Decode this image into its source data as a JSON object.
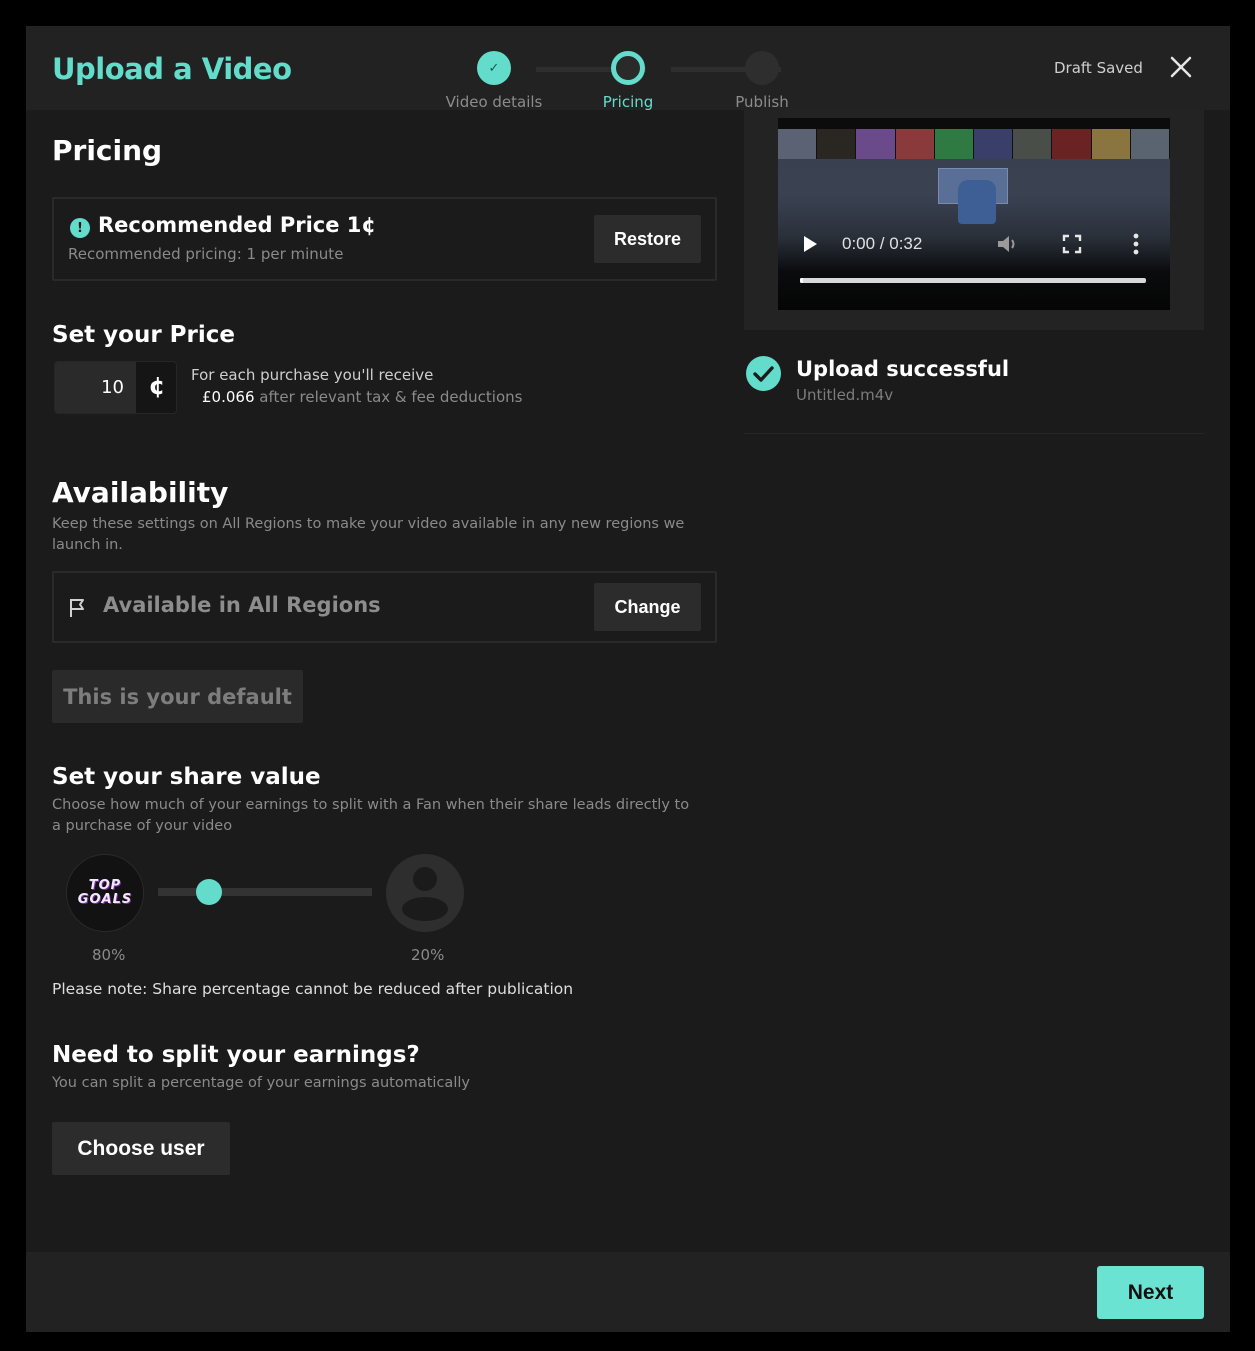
{
  "header": {
    "title": "Upload a Video",
    "draft_status": "Draft Saved",
    "close_icon": "close-icon"
  },
  "stepper": {
    "steps": [
      {
        "label": "Video details",
        "state": "done"
      },
      {
        "label": "Pricing",
        "state": "current"
      },
      {
        "label": "Publish",
        "state": "todo"
      }
    ],
    "check_glyph": "✓"
  },
  "pricing": {
    "title": "Pricing",
    "recommended": {
      "icon_glyph": "!",
      "title": "Recommended Price 1¢",
      "subtitle": "Recommended pricing: 1 per minute",
      "restore_label": "Restore"
    },
    "set_price": {
      "title": "Set your Price",
      "value": "10",
      "unit_glyph": "¢",
      "receive_line1": "For each purchase you'll receive",
      "receive_amount": "£0.066",
      "receive_suffix": " after relevant tax & fee deductions"
    }
  },
  "availability": {
    "title": "Availability",
    "description": "Keep these settings on All Regions to make your video available in any new regions we launch in.",
    "region_label": "Available in All Regions",
    "change_label": "Change",
    "default_label": "This is your default"
  },
  "share": {
    "title": "Set your share value",
    "description": "Choose how much of your earnings to split with a Fan when their share leads directly to a purchase of your video",
    "creator_logo_line1": "TOP",
    "creator_logo_line2": "GOALS",
    "creator_percent": "80%",
    "fan_percent": "20%",
    "slider_value_fan_percent": 20,
    "note": "Please note: Share percentage cannot be reduced after publication"
  },
  "split": {
    "title": "Need to split your earnings?",
    "description": "You can split a percentage of your earnings automatically",
    "choose_user_label": "Choose user"
  },
  "video": {
    "time": "0:00 / 0:32",
    "progress_fraction": 0.01,
    "thumb_colors": [
      "#5a6274",
      "#2a2622",
      "#6a4a8a",
      "#8a3a3a",
      "#2f7a42",
      "#3a3f6a",
      "#4a4e48",
      "#6a2222",
      "#8a7440",
      "#5a6470"
    ]
  },
  "upload": {
    "status": "Upload successful",
    "filename": "Untitled.m4v"
  },
  "footer": {
    "next_label": "Next"
  },
  "colors": {
    "accent": "#63dccb",
    "background": "#1b1b1b",
    "panel": "#222222"
  }
}
